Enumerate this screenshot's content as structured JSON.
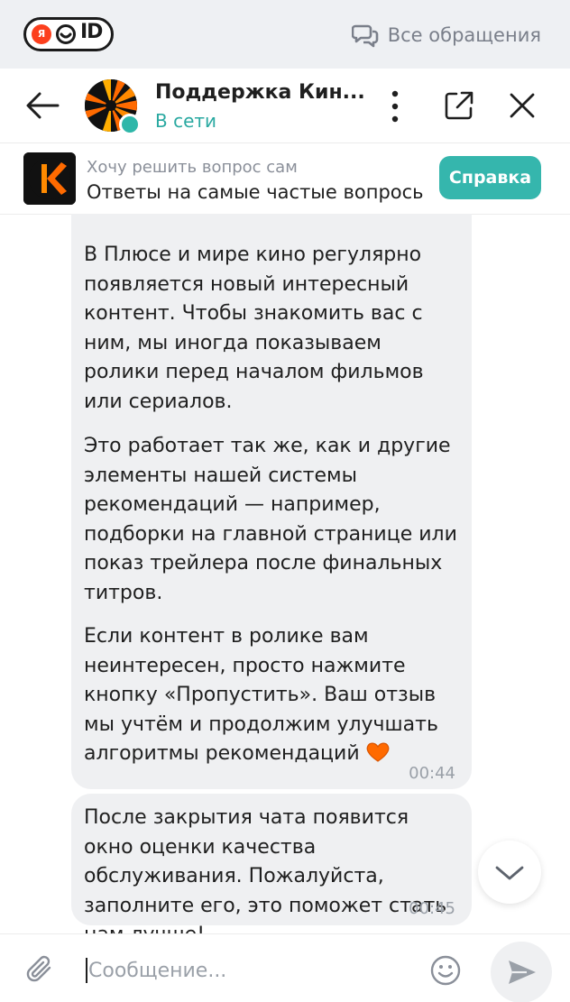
{
  "topbar": {
    "logo_ya": "Я",
    "logo_id": "ID",
    "all_requests": "Все обращения"
  },
  "chat": {
    "title": "Поддержка Кин...",
    "status": "В сети"
  },
  "help": {
    "caption": "Хочу решить вопрос сам",
    "description": "Ответы на самые частые вопрось",
    "button": "Справка"
  },
  "messages": [
    {
      "paragraphs": [
        "В Плюсе и мире кино регулярно появляется новый интересный контент. Чтобы знакомить вас с ним, мы иногда показываем ролики перед началом фильмов или сериалов.",
        "Это работает так же, как и другие элементы нашей системы рекомендаций — например, подборки на главной странице или показ трейлера после финальных титров.",
        "Если контент в ролике вам неинтересен, просто нажмите кнопку «Пропустить». Ваш отзыв мы учтём и продолжим улучшать алгоритмы рекомендаций"
      ],
      "time": "00:44"
    },
    {
      "paragraphs": [
        "После закрытия чата появится окно оценки качества обслуживания. Пожалуйста, заполните его, это поможет стать нам лучше!"
      ],
      "time": "00:45"
    }
  ],
  "composer": {
    "placeholder": "Сообщение..."
  },
  "colors": {
    "accent": "#35b6ad",
    "online": "#2aa9a1",
    "bubble": "#eff0f2",
    "heart": "#ff6a00"
  }
}
